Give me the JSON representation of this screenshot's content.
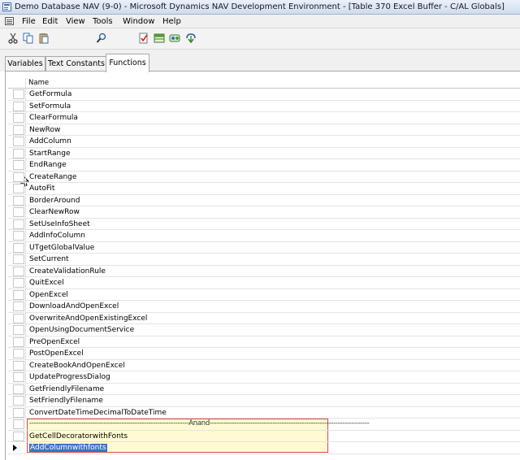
{
  "window": {
    "title": "Demo Database NAV (9-0) - Microsoft Dynamics NAV Development Environment - [Table 370 Excel Buffer - C/AL Globals]"
  },
  "menu": {
    "items": [
      "File",
      "Edit",
      "View",
      "Tools",
      "Window",
      "Help"
    ]
  },
  "toolbar": {
    "icons": [
      "cut-icon",
      "copy-icon",
      "paste-icon",
      "find-icon",
      "properties-icon",
      "table-icon",
      "symbols-icon",
      "compile-icon"
    ]
  },
  "tabs": [
    {
      "label": "Variables",
      "active": false
    },
    {
      "label": "Text Constants",
      "active": false
    },
    {
      "label": "Functions",
      "active": true
    }
  ],
  "grid": {
    "column_header": "Name",
    "functions": [
      "GetFormula",
      "SetFormula",
      "ClearFormula",
      "NewRow",
      "AddColumn",
      "StartRange",
      "EndRange",
      "CreateRange",
      "AutoFit",
      "BorderAround",
      "ClearNewRow",
      "SetUseInfoSheet",
      "AddInfoColumn",
      "UTgetGlobalValue",
      "SetCurrent",
      "CreateValidationRule",
      "QuitExcel",
      "OpenExcel",
      "DownloadAndOpenExcel",
      "OverwriteAndOpenExistingExcel",
      "OpenUsingDocumentService",
      "PreOpenExcel",
      "PostOpenExcel",
      "CreateBookAndOpenExcel",
      "UpdateProgressDialog",
      "GetFriendlyFilename",
      "SetFriendlyFilename",
      "ConvertDateTimeDecimalToDateTime"
    ],
    "custom_section": {
      "divider": "-----------------------------------------------------------------------Anand-----------------------------------------------------------------------",
      "items": [
        "GetCellDecoratorwithFonts"
      ],
      "selected_item": "AddColumnwithfonts"
    }
  },
  "colors": {
    "highlight_border": "#d24a4a",
    "highlight_fill": "#fffad2",
    "selection": "#3a75c4"
  }
}
